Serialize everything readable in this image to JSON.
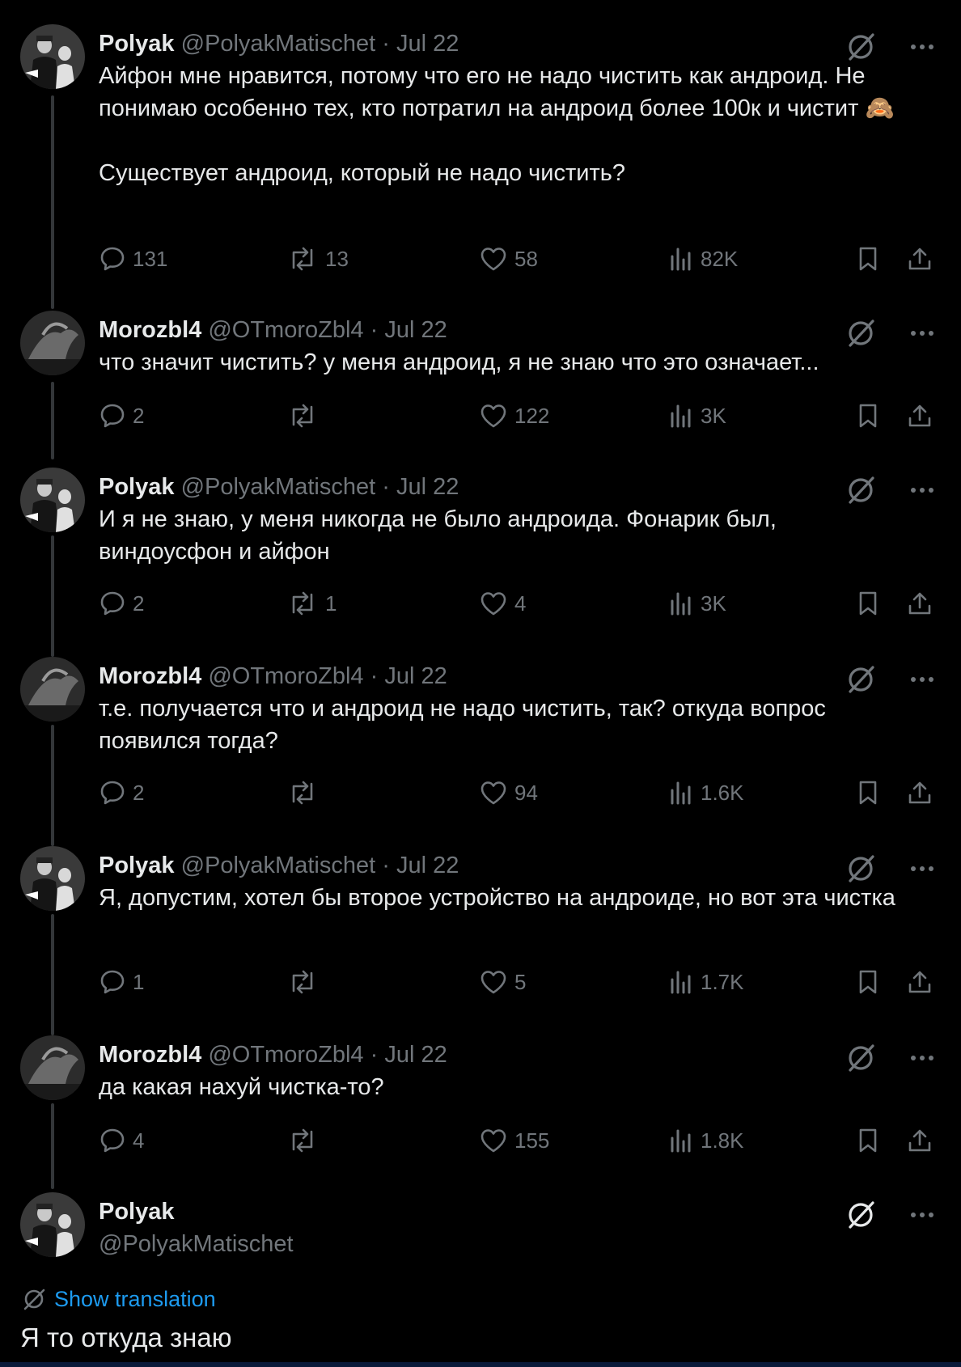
{
  "tweets": [
    {
      "name": "Polyak",
      "handle": "@PolyakMatischet",
      "date": "Jul 22",
      "paragraphs": [
        "Айфон мне нравится, потому что его не надо чистить как андроид. Не понимаю особенно тех, кто потратил на андроид более 100к и чистит 🙈",
        "Существует андроид, который не надо чистить?"
      ],
      "replies": "131",
      "reposts": "13",
      "likes": "58",
      "views": "82K"
    },
    {
      "name": "Morozbl4",
      "handle": "@OTmoroZbl4",
      "date": "Jul 22",
      "paragraphs": [
        "что значит чистить? у меня андроид, я не знаю что это означает..."
      ],
      "replies": "2",
      "reposts": "",
      "likes": "122",
      "views": "3K"
    },
    {
      "name": "Polyak",
      "handle": "@PolyakMatischet",
      "date": "Jul 22",
      "paragraphs": [
        "И я не знаю, у меня никогда не было андроида. Фонарик был, виндоусфон и айфон"
      ],
      "replies": "2",
      "reposts": "1",
      "likes": "4",
      "views": "3K"
    },
    {
      "name": "Morozbl4",
      "handle": "@OTmoroZbl4",
      "date": "Jul 22",
      "paragraphs": [
        "т.е. получается что и андроид не надо чистить, так? откуда вопрос появился тогда?"
      ],
      "replies": "2",
      "reposts": "",
      "likes": "94",
      "views": "1.6K"
    },
    {
      "name": "Polyak",
      "handle": "@PolyakMatischet",
      "date": "Jul 22",
      "paragraphs": [
        "Я, допустим, хотел бы второе устройство на андроиде, но вот эта чистка"
      ],
      "replies": "1",
      "reposts": "",
      "likes": "5",
      "views": "1.7K"
    },
    {
      "name": "Morozbl4",
      "handle": "@OTmoroZbl4",
      "date": "Jul 22",
      "paragraphs": [
        "да какая нахуй чистка-то?"
      ],
      "replies": "4",
      "reposts": "",
      "likes": "155",
      "views": "1.8K"
    }
  ],
  "main_tweet": {
    "name": "Polyak",
    "handle": "@PolyakMatischet",
    "show_translation": "Show translation",
    "text": "Я то откуда знаю"
  },
  "separator": "·",
  "colors": {
    "background": "#000000",
    "text": "#e7e9ea",
    "secondary": "#71767b",
    "link": "#1d9bf0",
    "thread_line": "#333639"
  },
  "icons": [
    "grok-icon",
    "more-icon",
    "reply-icon",
    "repost-icon",
    "like-icon",
    "views-icon",
    "bookmark-icon",
    "share-icon",
    "translate-icon"
  ]
}
